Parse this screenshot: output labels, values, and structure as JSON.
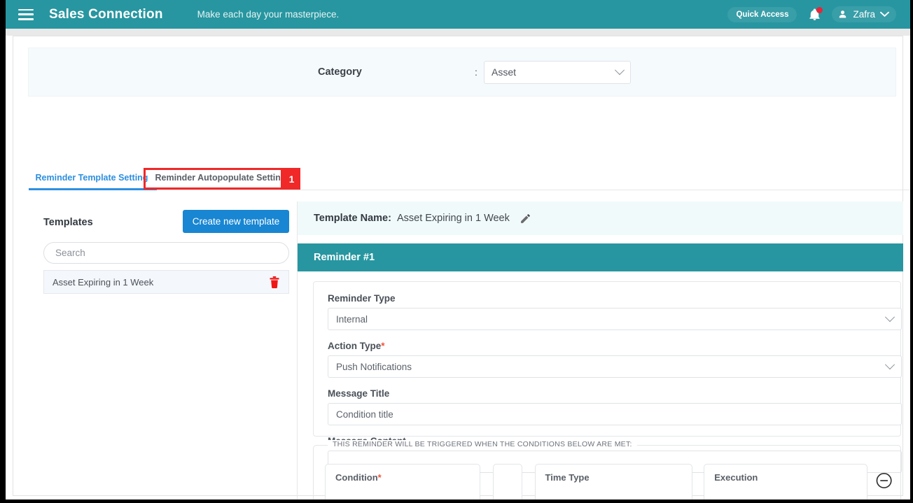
{
  "topbar": {
    "menu_icon": "hamburger-icon",
    "brand": "Sales Connection",
    "tagline": "Make each day your masterpiece.",
    "quick_access_label": "Quick Access",
    "bell_icon": "bell-icon",
    "user_name": "Zafra",
    "user_icon": "person-icon",
    "chevron_icon": "chevron-down-icon",
    "colors": {
      "teal": "#2796a0",
      "pill": "#389ea8",
      "badge_red": "#e8253a"
    }
  },
  "category": {
    "label": "Category",
    "colon": ":",
    "selected": "Asset"
  },
  "tabs": [
    {
      "label": "Reminder Template Setting",
      "active": true
    },
    {
      "label": "Reminder Autopopulate Setting",
      "active": false
    }
  ],
  "annotation": {
    "badge": "1",
    "color": "#f02828"
  },
  "templates_panel": {
    "title": "Templates",
    "create_button": "Create new template",
    "search_placeholder": "Search",
    "search_value": "",
    "items": [
      {
        "name": "Asset Expiring in 1 Week",
        "delete_icon": "trash-icon"
      }
    ]
  },
  "detail": {
    "template_name_label": "Template Name",
    "template_name_colon": ":",
    "template_name_value": "Asset Expiring in 1 Week",
    "edit_icon": "pencil-icon",
    "reminder_header": "Reminder #1",
    "fields": [
      {
        "label": "Reminder Type",
        "required": false,
        "value": "Internal",
        "type": "select"
      },
      {
        "label": "Action Type",
        "required": true,
        "value": "Push Notifications",
        "type": "select"
      },
      {
        "label": "Message Title",
        "required": false,
        "value": "Condition title",
        "type": "text"
      },
      {
        "label": "Message Content",
        "required": false,
        "value": "",
        "type": "text"
      }
    ],
    "trigger_legend": "THIS REMINDER WILL BE TRIGGERED WHEN THE CONDITIONS BELOW ARE MET:",
    "condition_row": {
      "condition_label": "Condition",
      "condition_required": true,
      "operator_label": "",
      "time_type_label": "Time Type",
      "execution_label": "Execution",
      "remove_icon": "minus-circle-icon"
    }
  },
  "colors": {
    "teal": "#2796a0",
    "blue": "#1886d2",
    "tab_active": "#2d8fe0",
    "red": "#f02828",
    "required": "#f0543a"
  }
}
